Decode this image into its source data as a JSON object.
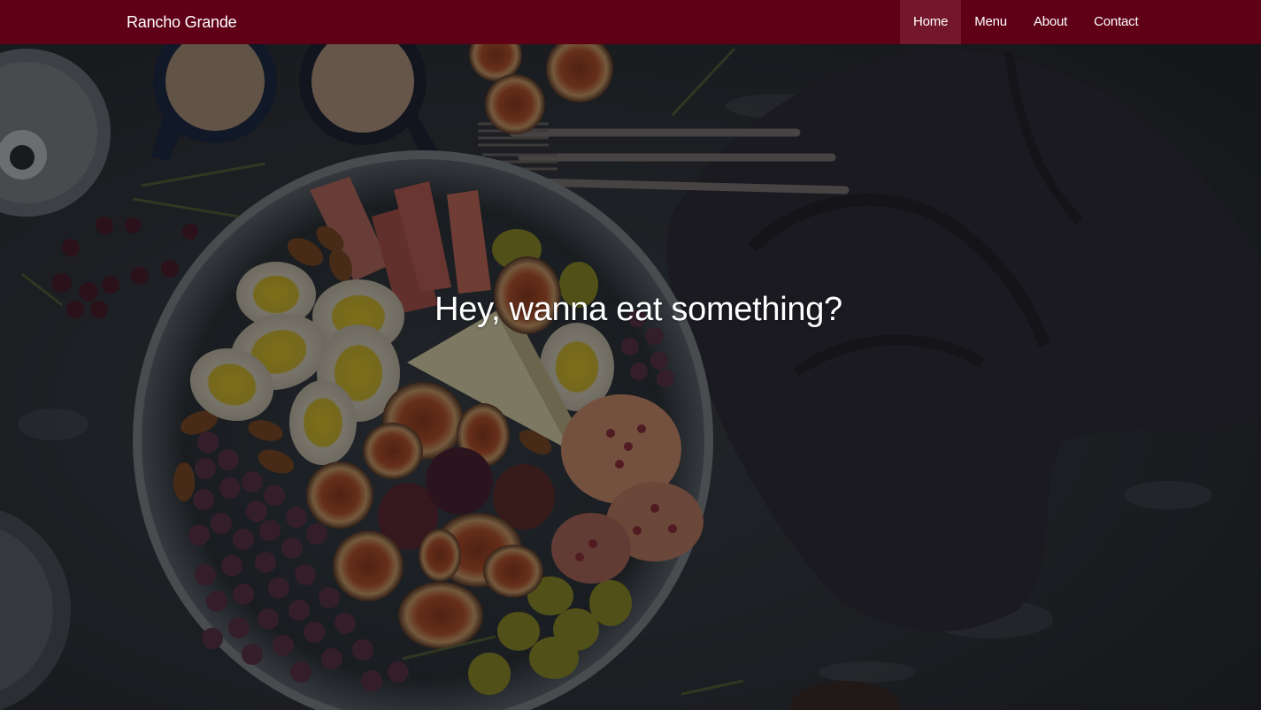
{
  "navbar": {
    "brand": "Rancho Grande",
    "items": [
      {
        "label": "Home",
        "active": true
      },
      {
        "label": "Menu",
        "active": false
      },
      {
        "label": "About",
        "active": false
      },
      {
        "label": "Contact",
        "active": false
      }
    ]
  },
  "hero": {
    "headline": "Hey, wanna eat something?",
    "background_image": "dark-food-platter-photo",
    "overlay_color": "#000000"
  },
  "colors": {
    "navbar_bg": "#5f0016",
    "navbar_active_bg": "#74172a",
    "text": "#ffffff"
  }
}
